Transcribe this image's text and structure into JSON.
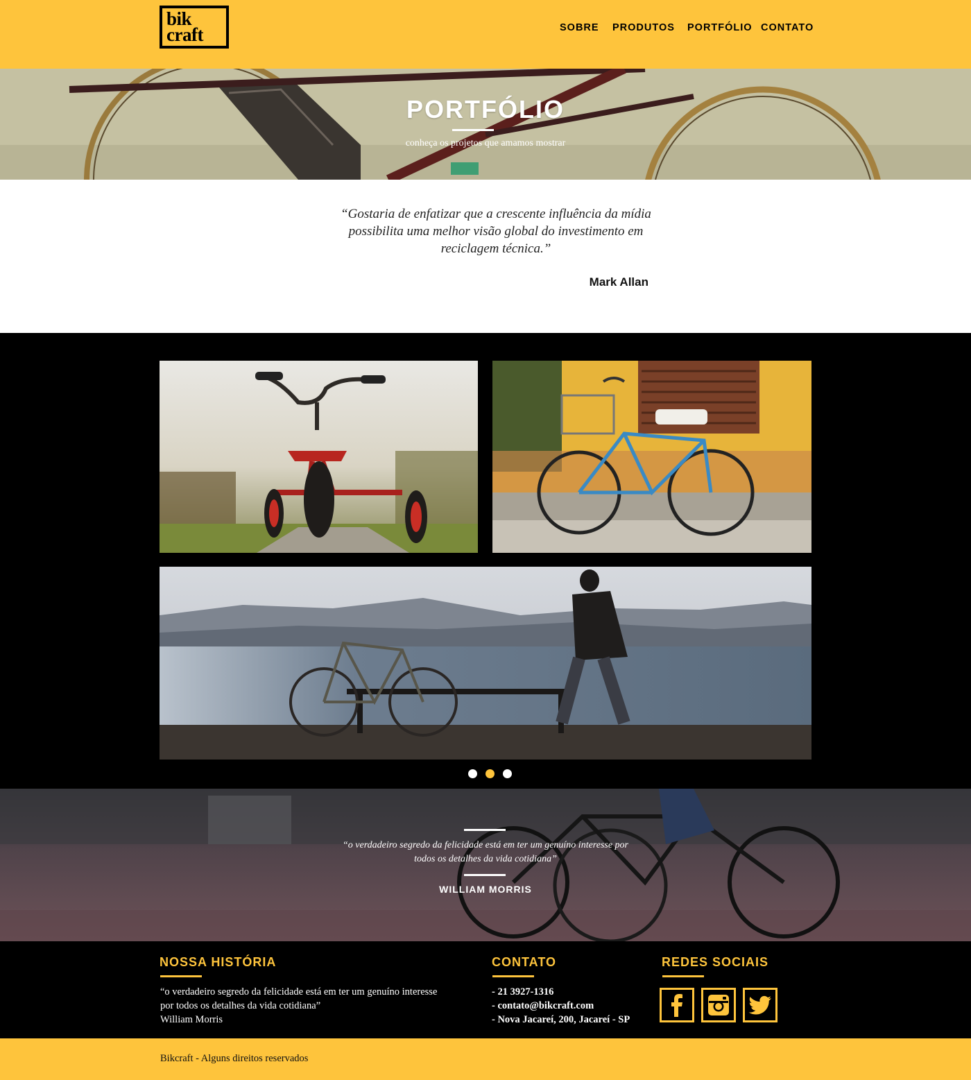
{
  "brand": {
    "logo_line1": "bik",
    "logo_line2": "craft"
  },
  "nav": {
    "items": [
      "SOBRE",
      "PRODUTOS",
      "PORTFÓLIO",
      "CONTATO"
    ]
  },
  "hero": {
    "title": "PORTFÓLIO",
    "subtitle": "conheça os projetos que amamos mostrar"
  },
  "quote": {
    "text": "“Gostaria de enfatizar que a crescente influência da mídia possibilita uma melhor visão global do investimento em reciclagem técnica.”",
    "author": "Mark Allan"
  },
  "gallery": {
    "photos": [
      "tricycle-photo",
      "blue-bicycle-photo",
      "lake-cyclist-photo"
    ],
    "dots": 3,
    "active_dot": 1
  },
  "band": {
    "quote": "“o verdadeiro segredo da felicidade está em ter um genuíno interesse por todos os detalhes da vida cotidiana”",
    "author": "WILLIAM MORRIS"
  },
  "footer": {
    "history_title": "NOSSA HISTÓRIA",
    "history_text": "“o verdadeiro segredo da felicidade está em ter um genuíno interesse por todos os detalhes da vida cotidiana”",
    "history_author": "William Morris",
    "contact_title": "CONTATO",
    "contact_phone": "- 21 3927-1316",
    "contact_email": "- contato@bikcraft.com",
    "contact_address": "- Nova Jacareí, 200, Jacareí - SP",
    "social_title": "REDES SOCIAIS",
    "social_icons": [
      "facebook-icon",
      "instagram-icon",
      "twitter-icon"
    ]
  },
  "copyright": "Bikcraft - Alguns direitos reservados",
  "colors": {
    "accent": "#FEC43C",
    "dark": "#000000"
  }
}
